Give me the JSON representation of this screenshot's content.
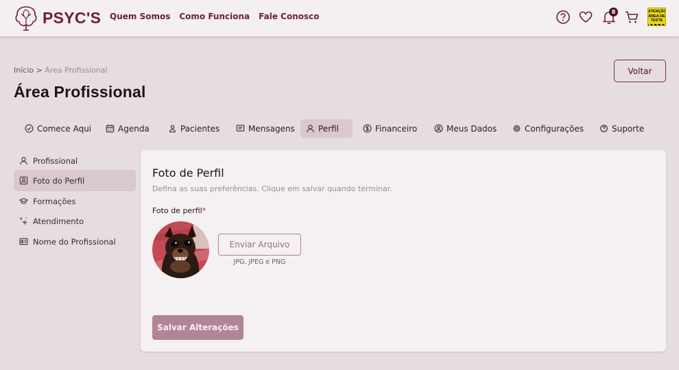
{
  "brand": {
    "name": "PSYC'S",
    "color": "#6b1e3c"
  },
  "header": {
    "nav": [
      "Quem Somos",
      "Como Funciona",
      "Fale Conosco"
    ],
    "notifications_count": "8",
    "test_flag": {
      "line1": "ATENÇÃO",
      "line2": "ÁREA DE",
      "line3": "TESTE"
    }
  },
  "breadcrumb": {
    "home": "Início",
    "separator": ">",
    "current": "Área Profissional"
  },
  "page_title": "Área Profissional",
  "back_button": "Voltar",
  "tabs": [
    {
      "label": "Comece Aqui",
      "icon": "check-circle-icon"
    },
    {
      "label": "Agenda",
      "icon": "calendar-icon"
    },
    {
      "label": "Pacientes",
      "icon": "users-icon"
    },
    {
      "label": "Mensagens",
      "icon": "message-icon"
    },
    {
      "label": "Perfil",
      "icon": "user-icon",
      "active": true
    },
    {
      "label": "Financeiro",
      "icon": "dollar-icon"
    },
    {
      "label": "Meus Dados",
      "icon": "user-circle-icon"
    },
    {
      "label": "Configurações",
      "icon": "gear-icon"
    },
    {
      "label": "Suporte",
      "icon": "help-icon"
    }
  ],
  "sidebar": [
    {
      "label": "Profissional",
      "icon": "user-icon"
    },
    {
      "label": "Foto do Perfil",
      "icon": "portrait-icon",
      "active": true
    },
    {
      "label": "Formações",
      "icon": "graduation-cap-icon"
    },
    {
      "label": "Atendimento",
      "icon": "sparkle-icon"
    },
    {
      "label": "Nome do Profissional",
      "icon": "id-card-icon"
    }
  ],
  "card": {
    "title": "Foto de Perfil",
    "subtitle": "Defina as suas preferências. Clique em salvar quando terminar.",
    "field_label": "Foto de perfil",
    "required_mark": "*",
    "upload_button": "Enviar Arquivo",
    "upload_hint": "JPG, JPEG e PNG",
    "save_button": "Salvar Alterações"
  },
  "colors": {
    "accent": "#6b1e3c",
    "active_bg": "#d9c8d0",
    "save_bg": "#b08597"
  }
}
